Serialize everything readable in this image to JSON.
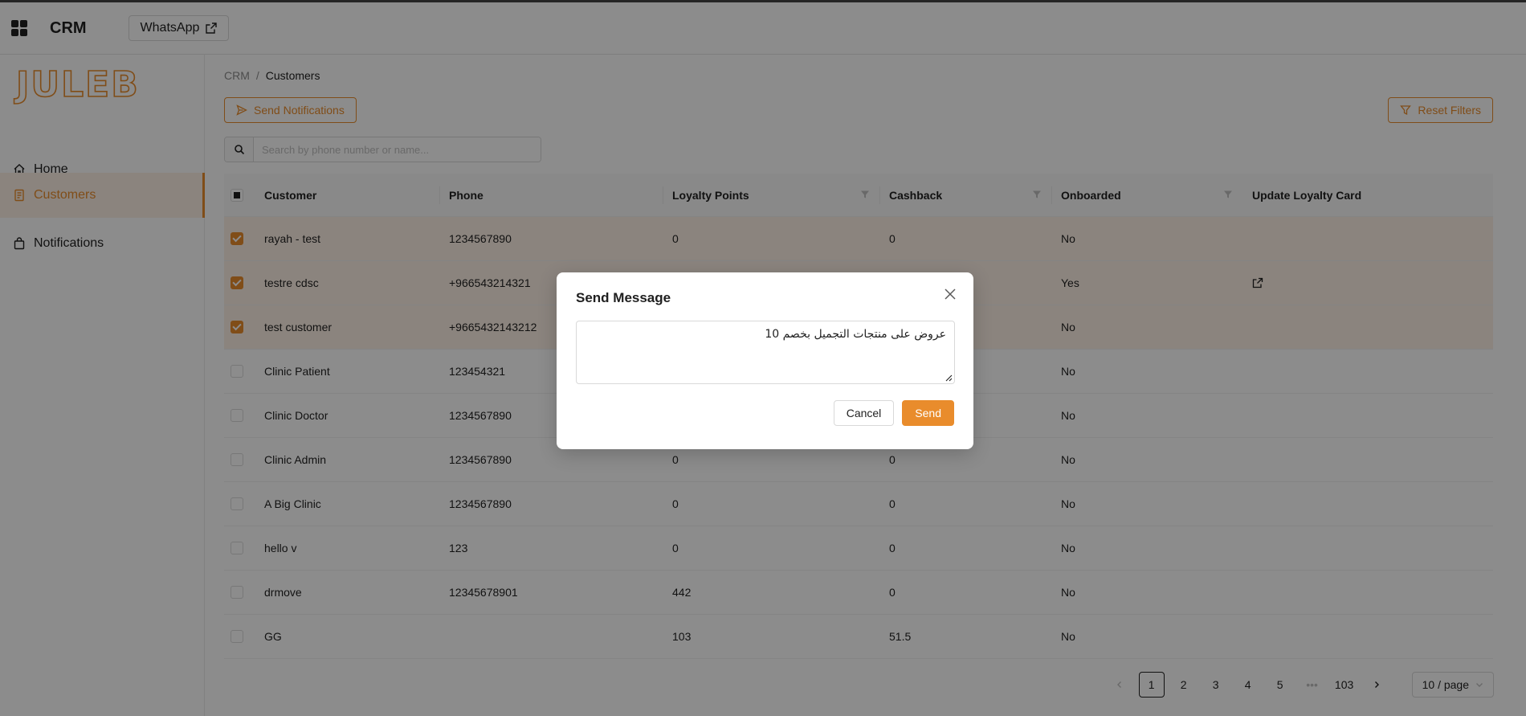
{
  "topbar": {
    "app_title": "CRM",
    "whatsapp_label": "WhatsApp"
  },
  "sidebar": {
    "logo_text": "JULEB",
    "items": [
      {
        "label": "Home",
        "icon": "home-icon"
      },
      {
        "label": "Customers",
        "icon": "document-icon",
        "active": true
      },
      {
        "label": "Notifications",
        "icon": "bag-icon"
      }
    ]
  },
  "breadcrumb": {
    "root": "CRM",
    "separator": "/",
    "current": "Customers"
  },
  "toolbar": {
    "send_notifications_label": "Send Notifications",
    "reset_filters_label": "Reset Filters",
    "search_placeholder": "Search by phone number or name..."
  },
  "table": {
    "headers": {
      "customer": "Customer",
      "phone": "Phone",
      "loyalty_points": "Loyalty Points",
      "cashback": "Cashback",
      "onboarded": "Onboarded",
      "update_loyalty_card": "Update Loyalty Card"
    },
    "rows": [
      {
        "customer": "rayah - test",
        "phone": "1234567890",
        "loyalty_points": "0",
        "cashback": "0",
        "onboarded": "No",
        "selected": true,
        "link": false
      },
      {
        "customer": "testre cdsc",
        "phone": "+966543214321",
        "loyalty_points": "",
        "cashback": "",
        "onboarded": "Yes",
        "selected": true,
        "link": true
      },
      {
        "customer": "test customer",
        "phone": "+9665432143212",
        "loyalty_points": "",
        "cashback": "",
        "onboarded": "No",
        "selected": true,
        "link": false
      },
      {
        "customer": "Clinic Patient",
        "phone": "123454321",
        "loyalty_points": "",
        "cashback": "",
        "onboarded": "No",
        "selected": false,
        "link": false
      },
      {
        "customer": "Clinic Doctor",
        "phone": "1234567890",
        "loyalty_points": "",
        "cashback": "",
        "onboarded": "No",
        "selected": false,
        "link": false
      },
      {
        "customer": "Clinic Admin",
        "phone": "1234567890",
        "loyalty_points": "0",
        "cashback": "0",
        "onboarded": "No",
        "selected": false,
        "link": false
      },
      {
        "customer": "A Big Clinic",
        "phone": "1234567890",
        "loyalty_points": "0",
        "cashback": "0",
        "onboarded": "No",
        "selected": false,
        "link": false
      },
      {
        "customer": "hello v",
        "phone": "123",
        "loyalty_points": "0",
        "cashback": "0",
        "onboarded": "No",
        "selected": false,
        "link": false
      },
      {
        "customer": "drmove",
        "phone": "12345678901",
        "loyalty_points": "442",
        "cashback": "0",
        "onboarded": "No",
        "selected": false,
        "link": false
      },
      {
        "customer": "GG",
        "phone": "",
        "loyalty_points": "103",
        "cashback": "51.5",
        "onboarded": "No",
        "selected": false,
        "link": false
      }
    ]
  },
  "pagination": {
    "pages": [
      "1",
      "2",
      "3",
      "4",
      "5"
    ],
    "ellipsis": "•••",
    "last_page": "103",
    "current": "1",
    "page_size": "10 / page"
  },
  "modal": {
    "title": "Send Message",
    "message_value": "عروض على منتجات التجميل بخصم 10",
    "cancel_label": "Cancel",
    "send_label": "Send"
  },
  "colors": {
    "accent": "#e98c2c",
    "selected_row": "#fdf1e6"
  }
}
